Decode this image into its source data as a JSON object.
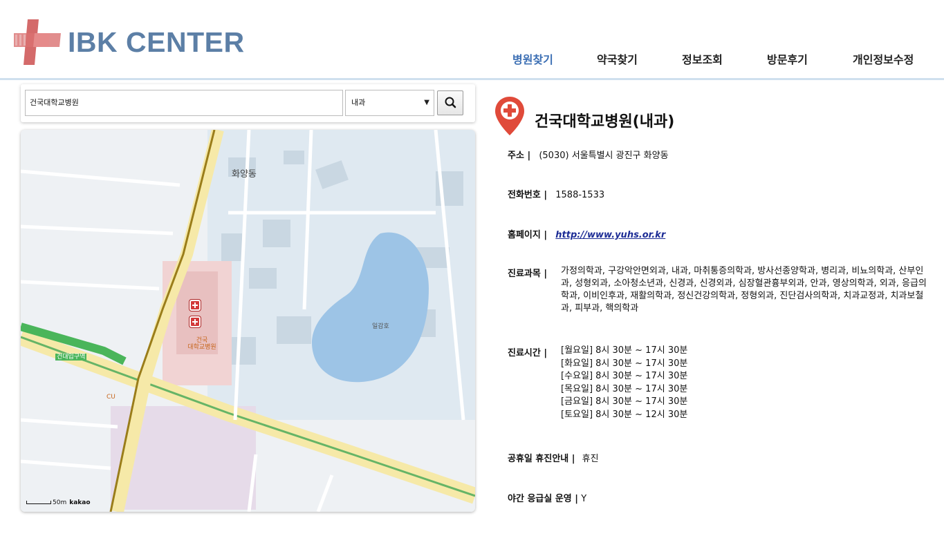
{
  "header": {
    "logo_text": "IBK CENTER",
    "nav": [
      {
        "label": "병원찾기",
        "active": true
      },
      {
        "label": "약국찾기",
        "active": false
      },
      {
        "label": "정보조회",
        "active": false
      },
      {
        "label": "방문후기",
        "active": false
      },
      {
        "label": "개인정보수정",
        "active": false
      }
    ]
  },
  "search": {
    "query": "건국대학교병원",
    "department": "내과",
    "button_icon": "search-icon"
  },
  "map": {
    "labels": {
      "hwayang": "화양동",
      "hospital": "건국\n대학교병원",
      "lake": "일감호",
      "cu": "CU",
      "konkuk_station": "건대입구역",
      "scale": "50m",
      "brand": "kakao"
    }
  },
  "detail": {
    "title": "건국대학교병원(내과)",
    "address_label": "주소 |",
    "address": "(5030) 서울특별시 광진구 화양동",
    "phone_label": "전화번호 |",
    "phone": "1588-1533",
    "homepage_label": "홈페이지 |",
    "homepage": "http://www.yuhs.or.kr",
    "departments_label": "진료과목 |",
    "departments": "가정의학과, 구강악안면외과, 내과, 마취통증의학과, 방사선종양학과, 병리과, 비뇨의학과, 산부인과, 성형외과, 소아청소년과, 신경과, 신경외과, 심장혈관흉부외과, 안과, 영상의학과, 외과, 응급의학과, 이비인후과, 재활의학과, 정신건강의학과, 정형외과, 진단검사의학과, 치과교정과, 치과보철과, 피부과, 핵의학과",
    "hours_label": "진료시간 |",
    "hours": [
      "[월요일] 8시 30분 ~ 17시 30분",
      "[화요일] 8시 30분 ~ 17시 30분",
      "[수요일] 8시 30분 ~ 17시 30분",
      "[목요일] 8시 30분 ~ 17시 30분",
      "[금요일] 8시 30분 ~ 17시 30분",
      "[토요일] 8시 30분 ~ 12시 30분"
    ],
    "holiday_label": "공휴일 휴진안내 |",
    "holiday": "휴진",
    "night_er_label": "야간 응급실 운영 |",
    "night_er": "Y"
  },
  "colors": {
    "brand": "#5c7fa6",
    "logo_cross": "#d9534f",
    "nav_active": "#3c6fb4",
    "marker": "#e04a3a",
    "lake": "#9dc4e6",
    "link": "#1c2c95"
  }
}
